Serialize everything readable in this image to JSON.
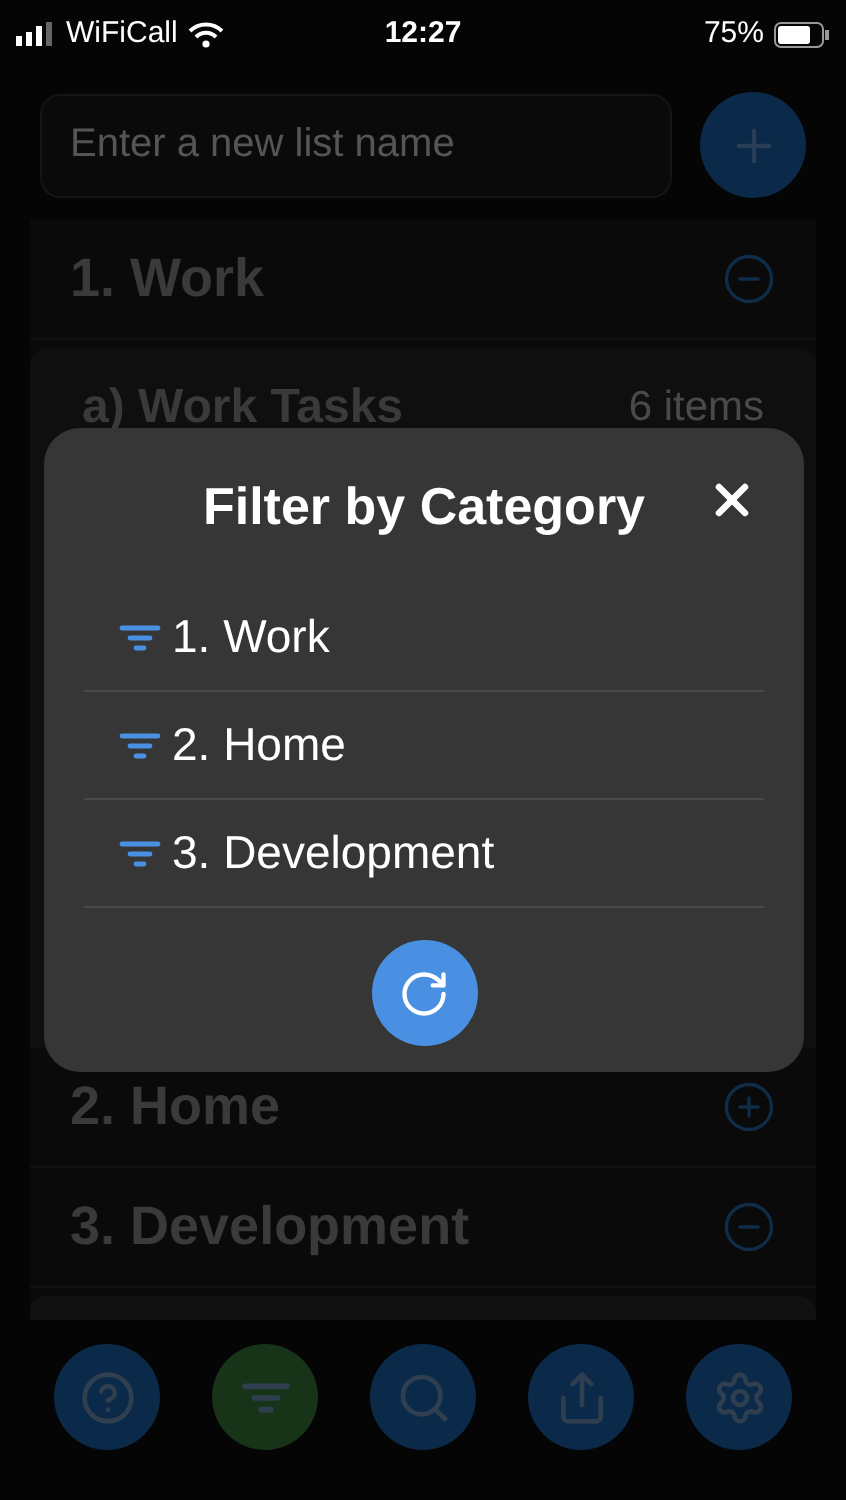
{
  "status_bar": {
    "carrier": "WiFiCall",
    "time": "12:27",
    "battery": "75%"
  },
  "new_list": {
    "placeholder": "Enter a new list name"
  },
  "lists": [
    {
      "title": "1. Work",
      "expanded": true,
      "sublists": [
        {
          "title": "a) Work Tasks",
          "count": "6 items"
        }
      ]
    },
    {
      "title": "2. Home",
      "expanded": false
    },
    {
      "title": "3. Development",
      "expanded": true
    }
  ],
  "toolbar": [
    {
      "kind": "help",
      "selected": false
    },
    {
      "kind": "filter",
      "selected": true
    },
    {
      "kind": "search",
      "selected": false
    },
    {
      "kind": "share",
      "selected": false
    },
    {
      "kind": "settings",
      "selected": false
    }
  ],
  "filter_dialog": {
    "title": "Filter by Category",
    "categories": [
      "1. Work",
      "2. Home",
      "3. Development"
    ]
  }
}
